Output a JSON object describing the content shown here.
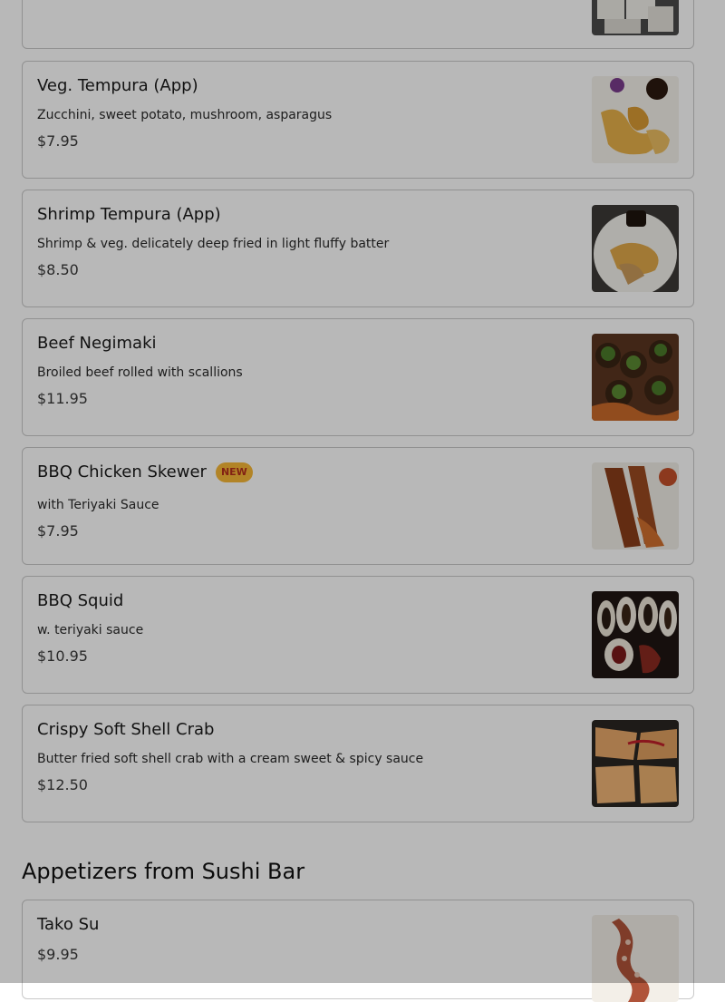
{
  "items": [
    {
      "title": "",
      "description": "",
      "price": ""
    },
    {
      "title": "Veg. Tempura (App)",
      "description": "Zucchini, sweet potato, mushroom, asparagus",
      "price": "$7.95"
    },
    {
      "title": "Shrimp Tempura (App)",
      "description": "Shrimp & veg. delicately deep fried in light fluffy batter",
      "price": "$8.50"
    },
    {
      "title": "Beef Negimaki",
      "description": "Broiled beef rolled with scallions",
      "price": "$11.95"
    },
    {
      "title": "BBQ Chicken Skewer",
      "badge": "NEW",
      "description": "with Teriyaki Sauce",
      "price": "$7.95"
    },
    {
      "title": "BBQ Squid",
      "description": "w. teriyaki sauce",
      "price": "$10.95"
    },
    {
      "title": "Crispy Soft Shell Crab",
      "description": "Butter fried soft shell crab with a cream sweet & spicy sauce",
      "price": "$12.50"
    }
  ],
  "section": {
    "title": "Appetizers from Sushi Bar"
  },
  "sushi_items": [
    {
      "title": "Tako Su",
      "price": "$9.95"
    }
  ],
  "colors": {
    "badge_bg": "#f7b836",
    "badge_text": "#b4301d",
    "overlay": "rgba(0,0,0,0.28)"
  }
}
